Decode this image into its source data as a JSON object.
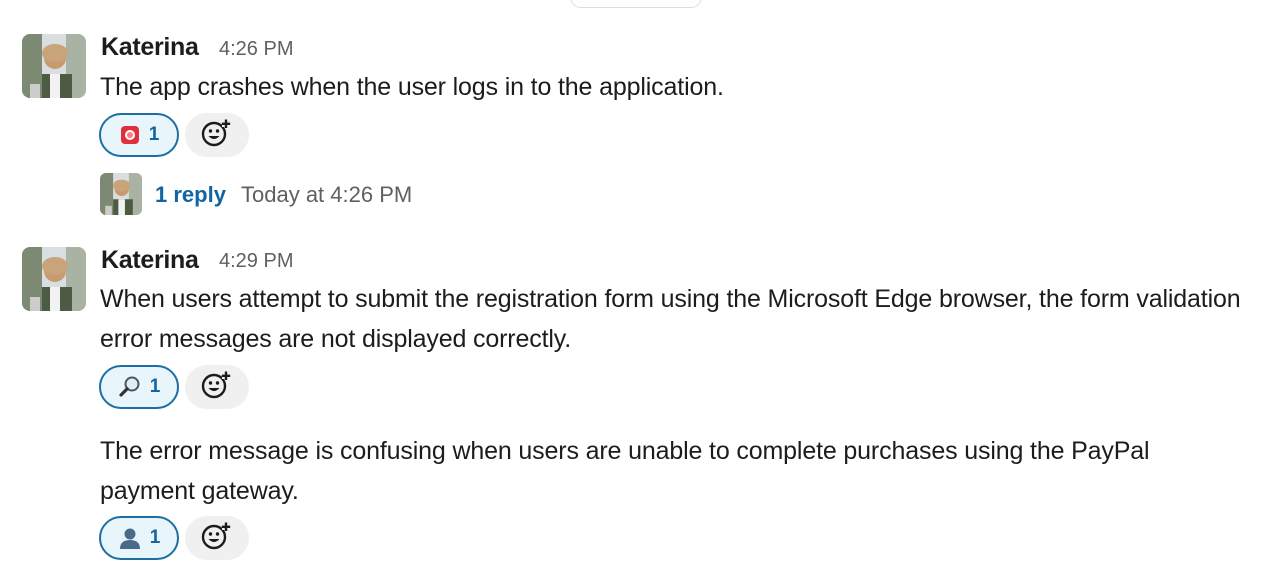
{
  "messages": [
    {
      "author": "Katerina",
      "time": "4:26 PM",
      "text": "The app crashes when the user logs in to the application.",
      "reaction": {
        "emoji": "rotating-light",
        "count": "1"
      },
      "thread": {
        "reply_count": "1 reply",
        "last_reply": "Today at 4:26 PM"
      }
    },
    {
      "author": "Katerina",
      "time": "4:29 PM",
      "text": "When users attempt to submit the registration form using the Microsoft Edge browser, the form validation error messages are not displayed correctly.",
      "reaction": {
        "emoji": "mag",
        "count": "1"
      }
    },
    {
      "text": "The error message is confusing when users are unable to complete purchases using the PayPal payment gateway.",
      "reaction": {
        "emoji": "bust-in-silhouette",
        "count": "1"
      }
    }
  ],
  "colors": {
    "link": "#1264a3",
    "reaction_border": "#1d6ea3",
    "reaction_bg": "#e8f5fa",
    "muted": "#616061"
  }
}
